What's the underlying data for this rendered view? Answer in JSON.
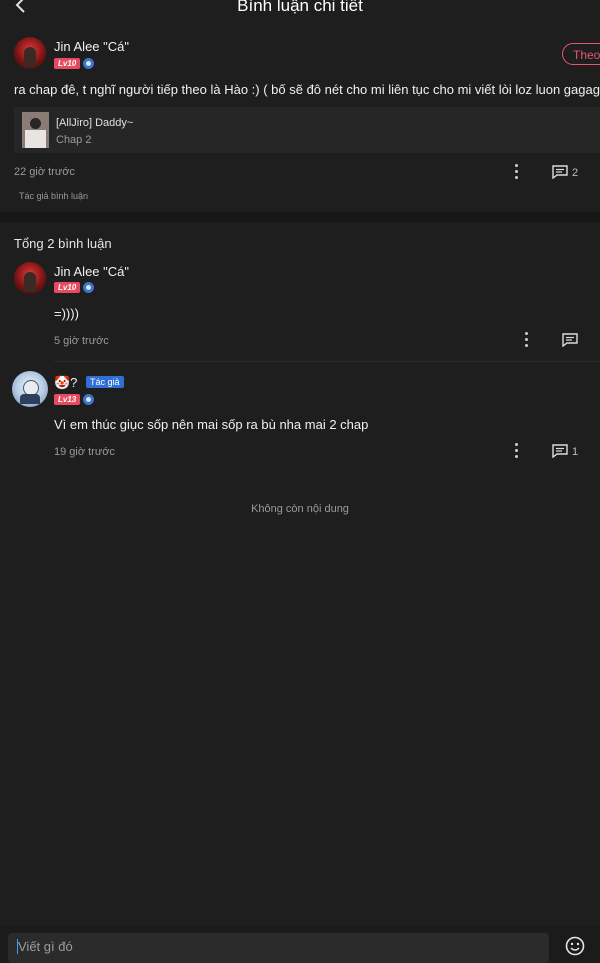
{
  "header": {
    "title": "Bình luận chi tiết"
  },
  "main_comment": {
    "author": "Jin Alee \"Cá\"",
    "level": "Lv10",
    "follow_label": "Theo",
    "text": "ra chap đê, t nghĩ người tiếp theo là Hào :) ( bố sẽ đô nét cho mi liên tục cho mi viết lòi loz luon gagaga)",
    "linked_manga": {
      "title": "[AllJiro] Daddy~",
      "chapter": "Chap 2"
    },
    "time": "22 giờ trước",
    "reply_count": "2",
    "author_tag": "Tác giả bình luận"
  },
  "replies_header": "Tổng 2 bình luận",
  "replies": [
    {
      "author": "Jin Alee \"Cá\"",
      "level": "Lv10",
      "text": "=))))",
      "time": "5 giờ trước",
      "reply_count": ""
    },
    {
      "author": "🤡?",
      "author_badge": "Tác giả",
      "level": "Lv13",
      "text": "Vì em thúc giục sốp nên mai sốp ra bù nha mai 2 chap",
      "time": "19 giờ trước",
      "reply_count": "1"
    }
  ],
  "end_note": "Không còn nội dung",
  "composer": {
    "placeholder": "Viết gì đó"
  },
  "colors": {
    "background": "#1e1e1e",
    "accent_red": "#e5566e",
    "level_badge": "#e84a62",
    "author_badge": "#2f6fd6"
  }
}
